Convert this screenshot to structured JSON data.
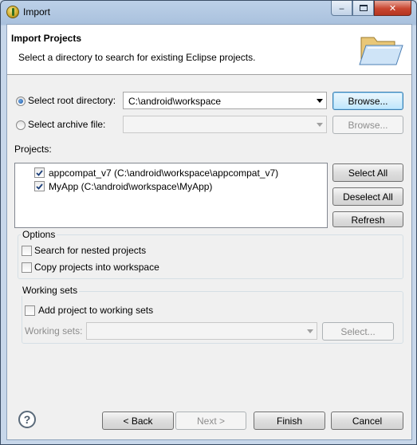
{
  "window": {
    "title": "Import"
  },
  "banner": {
    "title": "Import Projects",
    "description": "Select a directory to search for existing Eclipse projects."
  },
  "source": {
    "root_label": "Select root directory:",
    "root_value": "C:\\android\\workspace",
    "root_selected": true,
    "archive_label": "Select archive file:",
    "archive_value": "",
    "browse_label": "Browse...",
    "browse_archive_label": "Browse..."
  },
  "projects": {
    "label": "Projects:",
    "items": [
      {
        "label": "appcompat_v7 (C:\\android\\workspace\\appcompat_v7)",
        "checked": true
      },
      {
        "label": "MyApp (C:\\android\\workspace\\MyApp)",
        "checked": true
      }
    ],
    "select_all": "Select All",
    "deselect_all": "Deselect All",
    "refresh": "Refresh"
  },
  "options": {
    "legend": "Options",
    "nested": {
      "label": "Search for nested projects",
      "checked": false
    },
    "copy": {
      "label": "Copy projects into workspace",
      "checked": false
    }
  },
  "working_sets": {
    "legend": "Working sets",
    "add": {
      "label": "Add project to working sets",
      "checked": false
    },
    "field_label": "Working sets:",
    "field_value": "",
    "select_label": "Select..."
  },
  "footer": {
    "back": "< Back",
    "next": "Next >",
    "finish": "Finish",
    "cancel": "Cancel"
  },
  "colors": {
    "accent": "#3c7fb1",
    "title_bar": "#bcd0e8",
    "close_red": "#c8452f"
  },
  "icons": [
    "app-icon",
    "minimize-icon",
    "maximize-icon",
    "close-icon",
    "folder-icon",
    "help-icon",
    "chevron-down-icon",
    "checkmark-icon"
  ]
}
